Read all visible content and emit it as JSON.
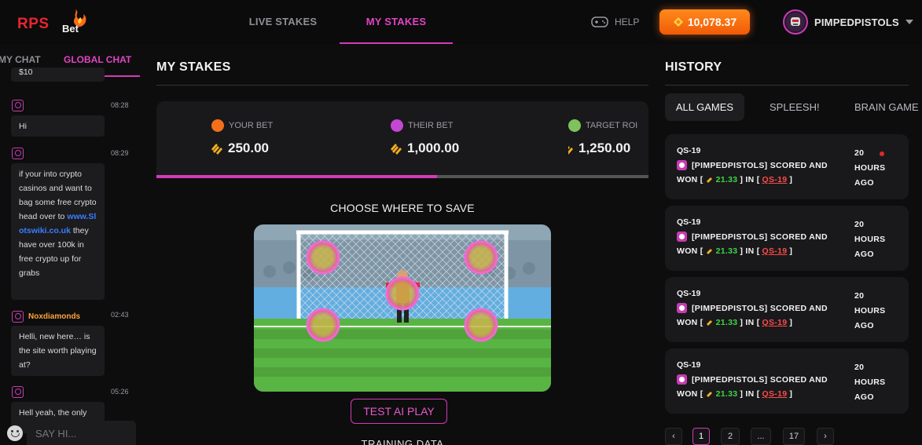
{
  "header": {
    "logo_text": "RPS",
    "logo_sub": "Bet",
    "nav": {
      "live": "LIVE STAKES",
      "mine": "MY STAKES"
    },
    "help": "HELP",
    "balance": "10,078.37",
    "username": "PIMPEDPISTOLS"
  },
  "chat": {
    "tabs": {
      "my": "MY CHAT",
      "global": "GLOBAL CHAT"
    },
    "partial_top": "$10",
    "messages": [
      {
        "time": "08:28",
        "name": "",
        "text": "Hi"
      },
      {
        "time": "08:29",
        "name": "",
        "text_before": "if your into crypto casinos and want to bag some free crypto head over to",
        "link": "www.Slotswiki.co.uk",
        "text_after": "they have over 100k in free crypto up for grabs"
      },
      {
        "time": "02:43",
        "name": "Noxdiamonds",
        "text": "Helli, new here… is the site worth playing at?"
      },
      {
        "time": "05:26",
        "name": "",
        "text": "Hell yeah, the only"
      }
    ],
    "input_placeholder": "SAY HI..."
  },
  "main": {
    "title": "MY STAKES",
    "stats": [
      {
        "label": "YOUR BET",
        "value": "250.00",
        "icon": "coins-icon",
        "color": "#f36f1c"
      },
      {
        "label": "THEIR BET",
        "value": "1,000.00",
        "icon": "coins-icon",
        "color": "#c447d4"
      },
      {
        "label": "TARGET ROI",
        "value": "1,250.00",
        "icon": "trophy-icon",
        "color": "#7fc25d"
      }
    ],
    "progress": 0.57,
    "choose_label": "CHOOSE WHERE TO SAVE",
    "ai_button": "TEST AI PLAY",
    "training_label": "TRAINING DATA"
  },
  "history": {
    "title": "HISTORY",
    "filters": [
      "ALL GAMES",
      "SPLEESH!",
      "BRAIN GAME"
    ],
    "entries": [
      {
        "game": "QS-19",
        "text": "[PIMPEDPISTOLS] SCORED AND",
        "won": "WON [",
        "amount": "21.33",
        "in": "] IN [",
        "link": "QS-19",
        "close": "]",
        "time": "20 HOURS AGO"
      },
      {
        "game": "QS-19",
        "text": "[PIMPEDPISTOLS] SCORED AND",
        "won": "WON [",
        "amount": "21.33",
        "in": "] IN [",
        "link": "QS-19",
        "close": "]",
        "time": "20 HOURS AGO"
      },
      {
        "game": "QS-19",
        "text": "[PIMPEDPISTOLS] SCORED AND",
        "won": "WON [",
        "amount": "21.33",
        "in": "] IN [",
        "link": "QS-19",
        "close": "]",
        "time": "20 HOURS AGO"
      },
      {
        "game": "QS-19",
        "text": "[PIMPEDPISTOLS] SCORED AND",
        "won": "WON [",
        "amount": "21.33",
        "in": "] IN [",
        "link": "QS-19",
        "close": "]",
        "time": "20 HOURS AGO"
      }
    ],
    "pagination": {
      "prev": "‹",
      "pages": [
        "1",
        "2",
        "...",
        "17"
      ],
      "next": "›",
      "current": "1"
    }
  },
  "colors": {
    "accent": "#d43ab8",
    "balance": "#f15a07",
    "win": "#3cd645",
    "link": "#ff4a4a",
    "name": "#ffa33a"
  }
}
